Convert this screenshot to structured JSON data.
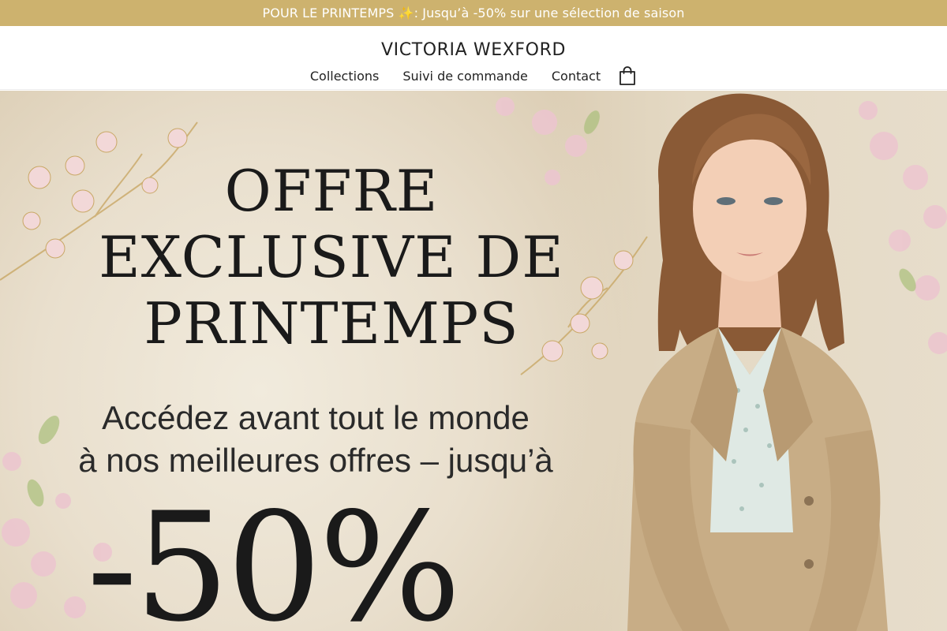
{
  "announcement": {
    "text": "POUR LE PRINTEMPS ✨: Jusqu’à -50% sur une sélection de saison"
  },
  "header": {
    "brand": "VICTORIA WEXFORD",
    "nav": [
      {
        "label": "Collections"
      },
      {
        "label": "Suivi de commande"
      },
      {
        "label": "Contact"
      }
    ],
    "cart_icon": "shopping-bag-icon"
  },
  "hero": {
    "title": "OFFRE\nEXCLUSIVE DE\nPRINTEMPS",
    "subtitle": "Accédez avant tout le monde\nà nos meilleures offres – jusqu’à",
    "discount": "-50%"
  },
  "colors": {
    "announcement_bg": "#cdb26e",
    "announcement_text": "#ffffff",
    "text_dark": "#222222",
    "trench_coat": "#c8ad86"
  }
}
